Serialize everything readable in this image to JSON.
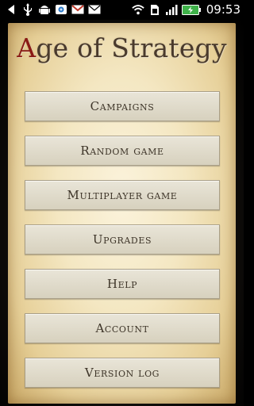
{
  "status_bar": {
    "time": "09:53",
    "icons": [
      "back-arrow-icon",
      "usb-icon",
      "android-debug-icon",
      "image-icon",
      "gmail-icon",
      "mail-icon",
      "wifi-icon",
      "sim-icon",
      "signal-icon",
      "battery-icon"
    ]
  },
  "app": {
    "title": "Age of Strategy",
    "title_accent_color": "#8a1a14",
    "menu": [
      {
        "label": "Campaigns"
      },
      {
        "label": "Random game"
      },
      {
        "label": "Multiplayer game"
      },
      {
        "label": "Upgrades"
      },
      {
        "label": "Help"
      },
      {
        "label": "Account"
      },
      {
        "label": "Version log"
      }
    ]
  }
}
